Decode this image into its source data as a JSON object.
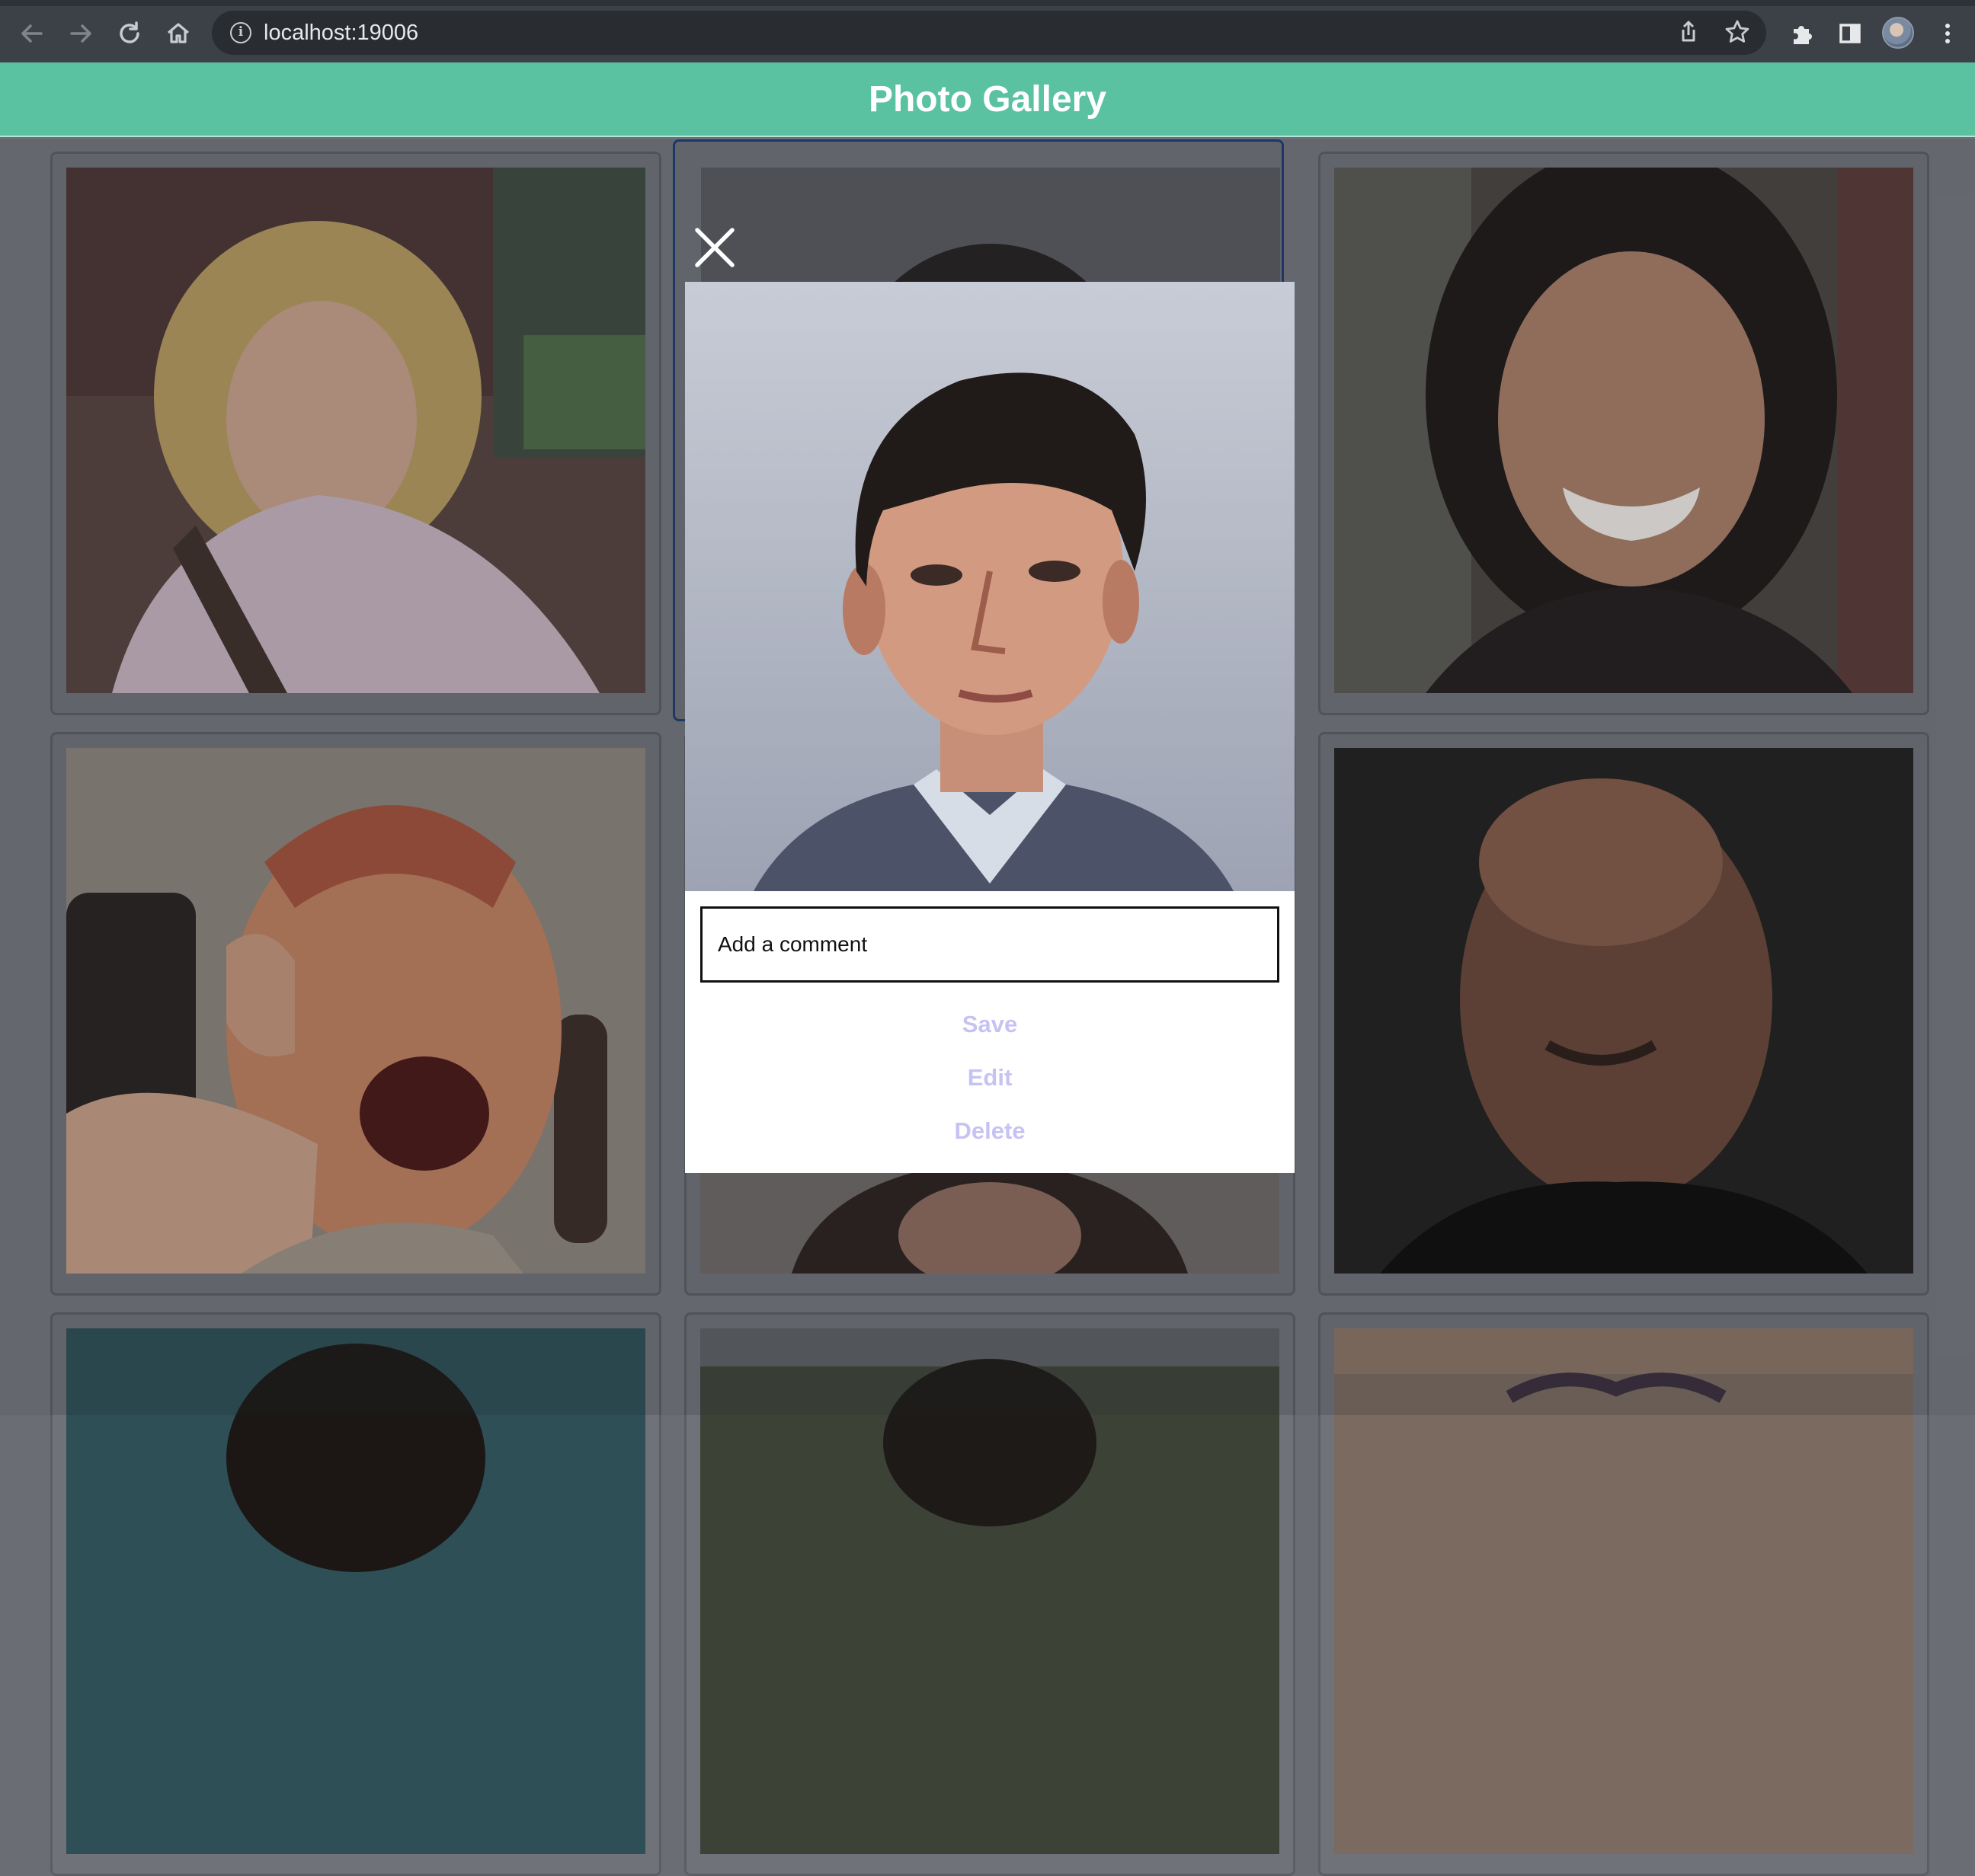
{
  "browser": {
    "url": "localhost:19006",
    "icons": [
      "back-icon",
      "forward-icon",
      "reload-icon",
      "home-icon",
      "info-icon",
      "share-icon",
      "star-icon",
      "extensions-icon",
      "sidepanel-icon",
      "profile-avatar",
      "menu-icon"
    ]
  },
  "header": {
    "title": "Photo Gallery"
  },
  "gallery": {
    "photos": [
      "woman-curly-blonde-hair",
      "young-man-dark-hair",
      "smiling-woman-dark-hair",
      "excited-man-thumbs-up",
      "woman-long-hair",
      "bald-man-dark-background",
      "man-teal-background",
      "man-outdoors",
      "person-sunglasses"
    ]
  },
  "modal": {
    "comment_placeholder": "Add a comment",
    "save_label": "Save",
    "edit_label": "Edit",
    "delete_label": "Delete"
  },
  "colors": {
    "header_bg": "#5ac1a1",
    "header_text": "#ffffff",
    "action_text": "#c6c3f4",
    "selected_border": "#1d3c74"
  }
}
